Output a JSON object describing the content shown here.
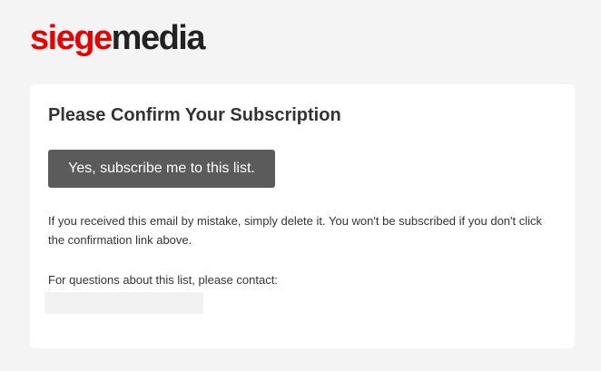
{
  "brand": {
    "logo_part1": "siege",
    "logo_part2": "media"
  },
  "card": {
    "title": "Please Confirm Your Subscription",
    "button_label": "Yes, subscribe me to this list.",
    "notice": "If you received this email by mistake, simply delete it. You won't be subscribed if you don't click the confirmation link above.",
    "contact_label": "For questions about this list, please contact:"
  },
  "colors": {
    "brand_red": "#e60000",
    "brand_dark": "#222222",
    "button_bg": "#5b5b5b",
    "page_bg": "#f4f4f4"
  }
}
